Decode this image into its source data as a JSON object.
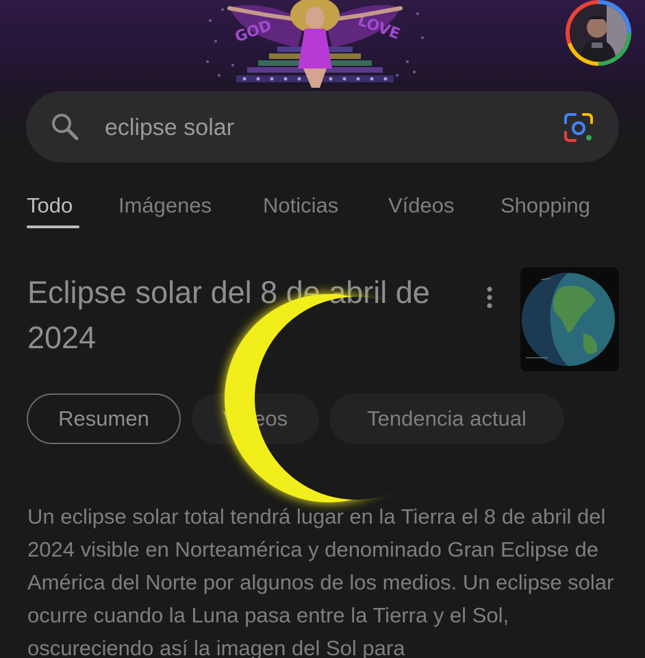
{
  "search": {
    "query": "eclipse solar"
  },
  "icons": {
    "search": "search-icon",
    "lens": "google-lens-camera-icon",
    "more": "more-vert-icon",
    "avatar": "profile-avatar"
  },
  "colors": {
    "background": "#1a1a1a",
    "doodle_purple": "#2e1a44",
    "eclipse_yellow": "#f2ee1a",
    "text_primary": "#bdbdbf",
    "text_secondary": "#7e7e80",
    "google_blue": "#4285f4",
    "google_red": "#ea4335",
    "google_yellow": "#fbbc05",
    "google_green": "#34a853"
  },
  "tabs": [
    {
      "label": "Todo",
      "active": true
    },
    {
      "label": "Imágenes",
      "active": false
    },
    {
      "label": "Noticias",
      "active": false
    },
    {
      "label": "Vídeos",
      "active": false
    },
    {
      "label": "Shopping",
      "active": false
    }
  ],
  "knowledge_panel": {
    "title": "Eclipse solar del 8 de abril de 2024",
    "chips": [
      {
        "label": "Resumen",
        "selected": true
      },
      {
        "label": "Videos",
        "selected": false
      },
      {
        "label": "Tendencia actual",
        "selected": false
      }
    ],
    "description": "Un eclipse solar total tendrá lugar en la Tierra el 8 de abril del 2024 visible en Norteamérica y denominado Gran Eclipse de América del Norte por algunos de los medios. Un eclipse solar ocurre cuando la Luna pasa entre la Tierra y el Sol, oscureciendo así la imagen del Sol para"
  }
}
